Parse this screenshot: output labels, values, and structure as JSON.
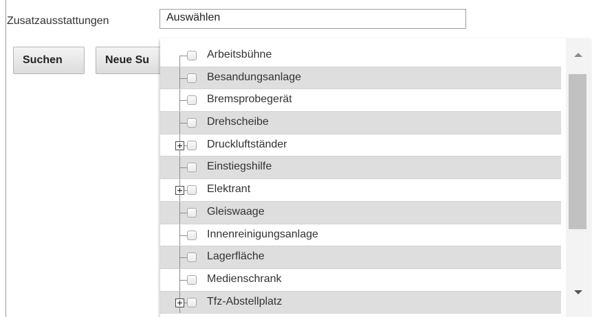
{
  "form": {
    "field_label": "Zusatzausstattungen",
    "select_value": "Auswählen"
  },
  "buttons": {
    "search": "Suchen",
    "new_search": "Neue Su"
  },
  "tree": {
    "items": [
      {
        "label": "Arbeitsbühne",
        "expandable": false
      },
      {
        "label": "Besandungsanlage",
        "expandable": false
      },
      {
        "label": "Bremsprobegerät",
        "expandable": false
      },
      {
        "label": "Drehscheibe",
        "expandable": false
      },
      {
        "label": "Druckluftständer",
        "expandable": true
      },
      {
        "label": "Einstiegshilfe",
        "expandable": false
      },
      {
        "label": "Elektrant",
        "expandable": true
      },
      {
        "label": "Gleiswaage",
        "expandable": false
      },
      {
        "label": "Innenreinigungsanlage",
        "expandable": false
      },
      {
        "label": "Lagerfläche",
        "expandable": false
      },
      {
        "label": "Medienschrank",
        "expandable": false
      },
      {
        "label": "Tfz-Abstellplatz",
        "expandable": true
      }
    ]
  },
  "icons": {
    "expand": "plus-box-icon",
    "scroll_up": "arrow-up-icon",
    "scroll_down": "arrow-down-icon"
  }
}
